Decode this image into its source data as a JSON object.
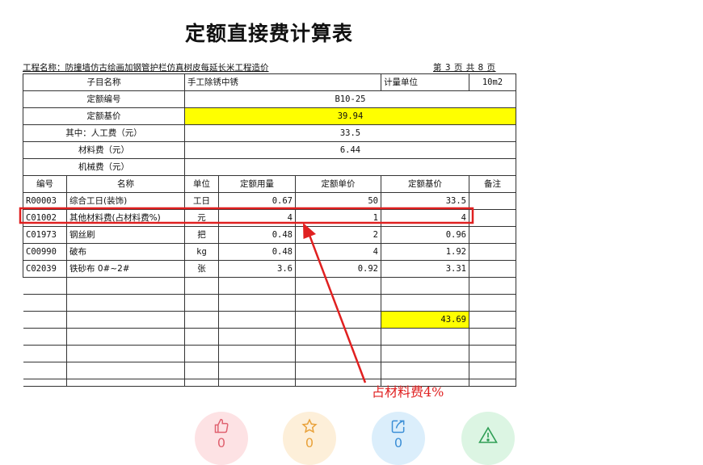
{
  "doc": {
    "title": "定额直接费计算表",
    "project": "工程名称：防撞墙仿古绘画加钢管护栏仿真树皮每延长米工程造价",
    "page_info": "第 3 页  共 8 页",
    "annotation": "占材料费4%"
  },
  "header": {
    "item_name_label": "子目名称",
    "item_name": "手工除锈中锈",
    "unit_label": "计量单位",
    "unit": "10m2",
    "code_label": "定额编号",
    "code": "B10-25",
    "base_price_label": "定额基价",
    "base_price": "39.94",
    "labor_label": "其中：人工费（元）",
    "labor": "33.5",
    "material_label": "材料费（元）",
    "material": "6.44",
    "machine_label": "机械费（元）",
    "machine": ""
  },
  "columns": [
    "编号",
    "名称",
    "单位",
    "定额用量",
    "定额单价",
    "定额基价",
    "备注"
  ],
  "rows": [
    {
      "code": "R00003",
      "name": "综合工日(装饰)",
      "unit": "工日",
      "qty": "0.67",
      "price": "50",
      "base": "33.5",
      "note": ""
    },
    {
      "code": "C01002",
      "name": "其他材料费(占材料费%)",
      "unit": "元",
      "qty": "4",
      "price": "1",
      "base": "4",
      "note": ""
    },
    {
      "code": "C01973",
      "name": "钢丝刷",
      "unit": "把",
      "qty": "0.48",
      "price": "2",
      "base": "0.96",
      "note": ""
    },
    {
      "code": "C00990",
      "name": "破布",
      "unit": "kg",
      "qty": "0.48",
      "price": "4",
      "base": "1.92",
      "note": ""
    },
    {
      "code": "C02039",
      "name": "铁砂布 0#~2#",
      "unit": "张",
      "qty": "3.6",
      "price": "0.92",
      "base": "3.31",
      "note": ""
    }
  ],
  "total": "43.69",
  "actions": {
    "like": {
      "icon": "thumbs-up-icon",
      "count": "0",
      "color": "#fde2e4"
    },
    "star": {
      "icon": "star-icon",
      "count": "0",
      "color": "#fdefd9"
    },
    "share": {
      "icon": "share-icon",
      "count": "0",
      "color": "#dbeefb"
    },
    "report": {
      "icon": "warning-icon",
      "color": "#dcf5e3"
    }
  },
  "colors": {
    "highlight": "#ffff00",
    "annotation_red": "#e02020"
  }
}
